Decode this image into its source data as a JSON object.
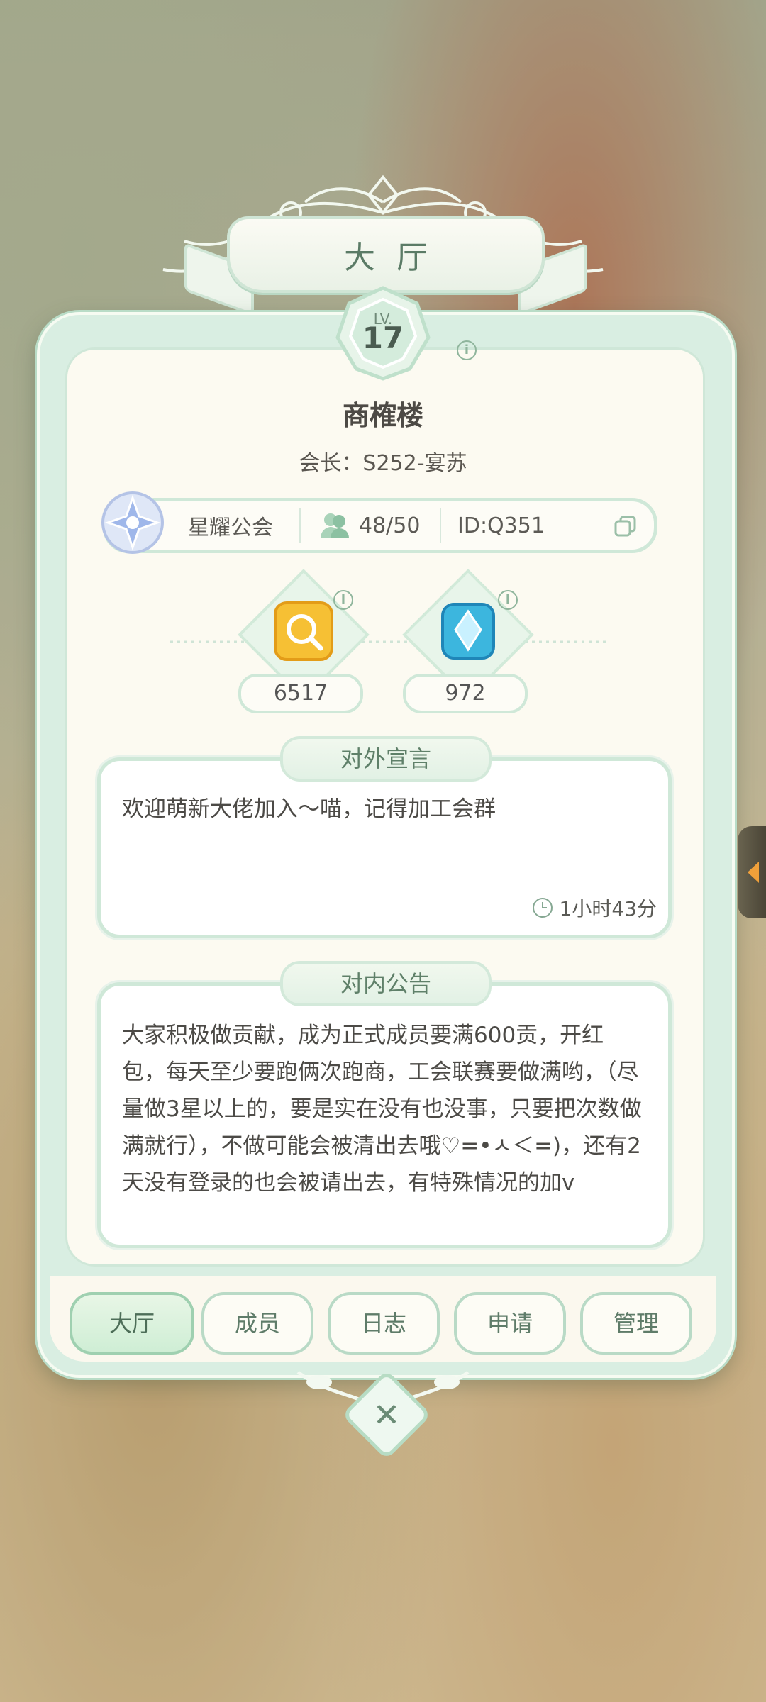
{
  "header": {
    "title": "大厅"
  },
  "guild": {
    "level_prefix": "LV.",
    "level": "17",
    "name": "商榷楼",
    "leader": "会长：S252-宴苏",
    "tier": "星耀公会",
    "members": "48/50",
    "id": "ID:Q351"
  },
  "resources": [
    {
      "icon": "gold-search-icon",
      "value": "6517"
    },
    {
      "icon": "blue-crystal-icon",
      "value": "972"
    }
  ],
  "external": {
    "title": "对外宣言",
    "text": "欢迎萌新大佬加入～喵，记得加工会群",
    "timestamp": "1小时43分"
  },
  "internal": {
    "title": "对内公告",
    "text": "大家积极做贡献，成为正式成员要满600贡，开红包，每天至少要跑俩次跑商，工会联赛要做满哟，（尽量做3星以上的，要是实在没有也没事，只要把次数做满就行），不做可能会被清出去哦♡=•ㅅ＜=)，还有2天没有登录的也会被请出去，有特殊情况的加v"
  },
  "tabs": [
    {
      "label": "大厅",
      "active": true
    },
    {
      "label": "成员",
      "active": false
    },
    {
      "label": "日志",
      "active": false
    },
    {
      "label": "申请",
      "active": false
    },
    {
      "label": "管理",
      "active": false
    }
  ],
  "colors": {
    "accent": "#cfe8d8",
    "panel": "#fcfaf1",
    "text": "#4c4a46"
  }
}
